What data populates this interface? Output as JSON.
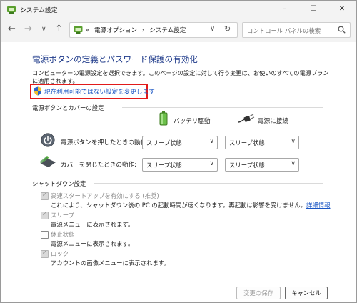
{
  "window": {
    "title": "システム設定"
  },
  "window_controls": {
    "minimize": "–",
    "maximize": "☐",
    "close": "✕"
  },
  "nav": {
    "back": "←",
    "forward": "→",
    "recent": "∨",
    "up": "↑"
  },
  "address": {
    "prefix": "«",
    "crumbs": [
      "電源オプション",
      "システム設定"
    ],
    "separator": "›",
    "dropdown": "∨",
    "refresh": "↻"
  },
  "search": {
    "placeholder": "コントロール パネルの検索"
  },
  "page": {
    "title": "電源ボタンの定義とパスワード保護の有効化",
    "description": "コンピューターの電源設定を選択できます。このページの設定に対して行う変更は、お使いのすべての電源プランに適用されます。",
    "change_link": "現在利用可能ではない設定を変更します"
  },
  "power_section": {
    "heading": "電源ボタンとカバーの設定",
    "columns": {
      "battery": "バッテリ駆動",
      "plugged": "電源に接続"
    },
    "rows": [
      {
        "label": "電源ボタンを押したときの動作:",
        "battery": "スリープ状態",
        "plugged": "スリープ状態"
      },
      {
        "label": "カバーを閉じたときの動作:",
        "battery": "スリープ状態",
        "plugged": "スリープ状態"
      }
    ]
  },
  "shutdown_section": {
    "heading": "シャットダウン設定",
    "items": [
      {
        "label": "高速スタートアップを有効にする (推奨)",
        "checked": true,
        "desc": "これにより、シャットダウン後の PC の起動時間が速くなります。再起動は影響を受けません。",
        "link": "詳細情報"
      },
      {
        "label": "スリープ",
        "checked": true,
        "desc": "電源メニューに表示されます。"
      },
      {
        "label": "休止状態",
        "checked": false,
        "desc": "電源メニューに表示されます。"
      },
      {
        "label": "ロック",
        "checked": true,
        "desc": "アカウントの画像メニューに表示されます。"
      }
    ]
  },
  "buttons": {
    "save": "変更の保存",
    "cancel": "キャンセル"
  },
  "icons": {
    "chevron_down": "∨",
    "check": "✓"
  },
  "colors": {
    "title_blue": "#1e3a8a",
    "link_blue": "#1a56c4",
    "highlight_red": "#e21a1a",
    "battery_green": "#6cc04a"
  }
}
